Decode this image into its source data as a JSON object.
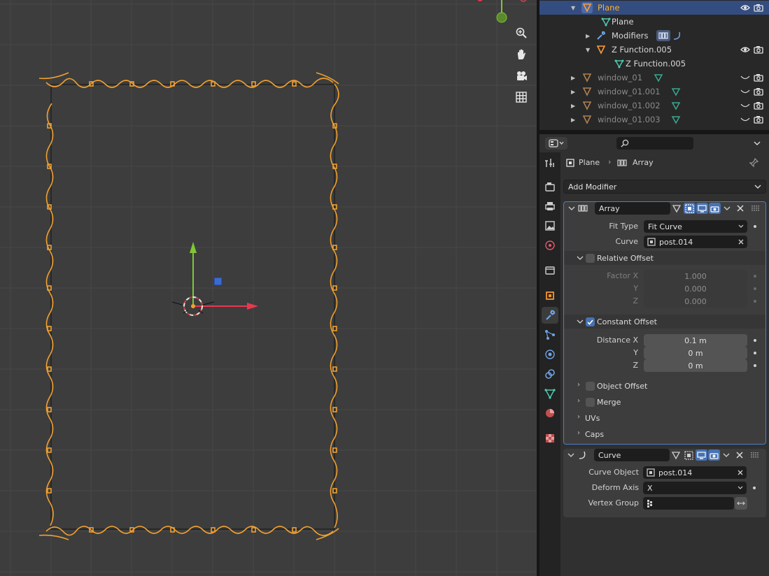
{
  "outliner": {
    "rows": [
      {
        "label": "Plane"
      },
      {
        "label": "Plane"
      },
      {
        "label": "Modifiers"
      },
      {
        "label": "Z Function.005"
      },
      {
        "label": "Z Function.005"
      },
      {
        "label": "window_01"
      },
      {
        "label": "window_01.001"
      },
      {
        "label": "window_01.002"
      },
      {
        "label": "window_01.003"
      }
    ]
  },
  "properties": {
    "breadcrumb": {
      "object": "Plane",
      "modifier": "Array"
    },
    "add_modifier": "Add Modifier",
    "array": {
      "name": "Array",
      "fit_type_label": "Fit Type",
      "fit_type_value": "Fit Curve",
      "curve_label": "Curve",
      "curve_value": "post.014",
      "relative_offset": {
        "label": "Relative Offset",
        "enabled": false,
        "factor_x_label": "Factor X",
        "factor_x": "1.000",
        "y_label": "Y",
        "y": "0.000",
        "z_label": "Z",
        "z": "0.000"
      },
      "constant_offset": {
        "label": "Constant Offset",
        "enabled": true,
        "distance_x_label": "Distance X",
        "distance_x": "0.1 m",
        "y_label": "Y",
        "y": "0 m",
        "z_label": "Z",
        "z": "0 m"
      },
      "object_offset_label": "Object Offset",
      "merge_label": "Merge",
      "uvs_label": "UVs",
      "caps_label": "Caps"
    },
    "curve": {
      "name": "Curve",
      "curve_object_label": "Curve Object",
      "curve_object_value": "post.014",
      "deform_axis_label": "Deform Axis",
      "deform_axis_value": "X",
      "vertex_group_label": "Vertex Group",
      "vertex_group_value": ""
    }
  },
  "colors": {
    "accent_blue": "#4772b3",
    "selected_orange": "#ffaf29",
    "viewport_bg": "#3d3d3d",
    "gizmo_x": "#e8384f",
    "gizmo_y": "#7ec735"
  }
}
